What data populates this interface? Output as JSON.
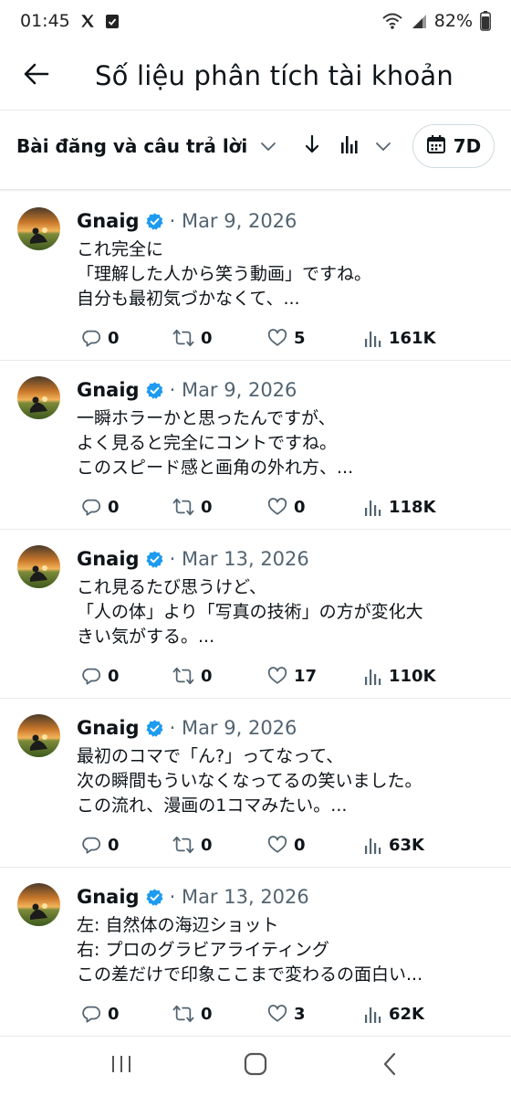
{
  "status_bar": {
    "time": "01:45",
    "battery": "82%"
  },
  "header": {
    "title": "Số liệu phân tích tài khoản"
  },
  "filters": {
    "content_type": "Bài đăng và câu trả lời",
    "date_range": "7D"
  },
  "posts": [
    {
      "author": "Gnaig",
      "date": "Mar 9, 2026",
      "lines": [
        "これ完全に",
        "「理解した人から笑う動画」ですね。",
        "自分も最初気づかなくて、..."
      ],
      "replies": "0",
      "reposts": "0",
      "likes": "5",
      "views": "161K"
    },
    {
      "author": "Gnaig",
      "date": "Mar 9, 2026",
      "lines": [
        "一瞬ホラーかと思ったんですが、",
        "よく見ると完全にコントですね。",
        "このスピード感と画角の外れ方、..."
      ],
      "replies": "0",
      "reposts": "0",
      "likes": "0",
      "views": "118K"
    },
    {
      "author": "Gnaig",
      "date": "Mar 13, 2026",
      "lines": [
        "これ見るたび思うけど、",
        "「人の体」より「写真の技術」の方が変化大",
        "きい気がする。..."
      ],
      "replies": "0",
      "reposts": "0",
      "likes": "17",
      "views": "110K"
    },
    {
      "author": "Gnaig",
      "date": "Mar 9, 2026",
      "lines": [
        "最初のコマで「ん?」ってなって、",
        "次の瞬間もういなくなってるの笑いました。",
        "この流れ、漫画の1コマみたい。..."
      ],
      "replies": "0",
      "reposts": "0",
      "likes": "0",
      "views": "63K"
    },
    {
      "author": "Gnaig",
      "date": "Mar 13, 2026",
      "lines": [
        "左: 自然体の海辺ショット",
        "右: プロのグラビアライティング",
        "この差だけで印象ここまで変わるの面白い..."
      ],
      "replies": "0",
      "reposts": "0",
      "likes": "3",
      "views": "62K"
    }
  ],
  "icons": {
    "back": "arrow-left-icon",
    "sort": "arrow-down-icon",
    "metric": "bar-chart-icon",
    "calendar": "calendar-icon",
    "verified": "verified-badge-icon",
    "reply": "reply-icon",
    "repost": "repost-icon",
    "like": "heart-icon",
    "views": "views-icon"
  },
  "colors": {
    "verified": "#1d9bf0",
    "text_primary": "#0f1419",
    "text_secondary": "#536471"
  }
}
